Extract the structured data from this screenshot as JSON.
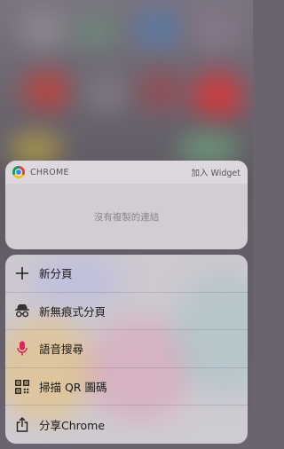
{
  "widget": {
    "app_name": "CHROME",
    "add_widget_label": "加入 Widget",
    "empty_message": "沒有複製的連結"
  },
  "menu": {
    "items": [
      {
        "label": "新分頁",
        "icon": "plus-icon"
      },
      {
        "label": "新無痕式分頁",
        "icon": "incognito-icon"
      },
      {
        "label": "語音搜尋",
        "icon": "microphone-icon"
      },
      {
        "label": "掃描 QR 圖碼",
        "icon": "qr-code-icon"
      },
      {
        "label": "分享Chrome",
        "icon": "share-icon"
      }
    ]
  },
  "colors": {
    "mic_accent": "#e0245e",
    "text_primary": "#1a1a1a",
    "text_secondary": "#555555"
  }
}
